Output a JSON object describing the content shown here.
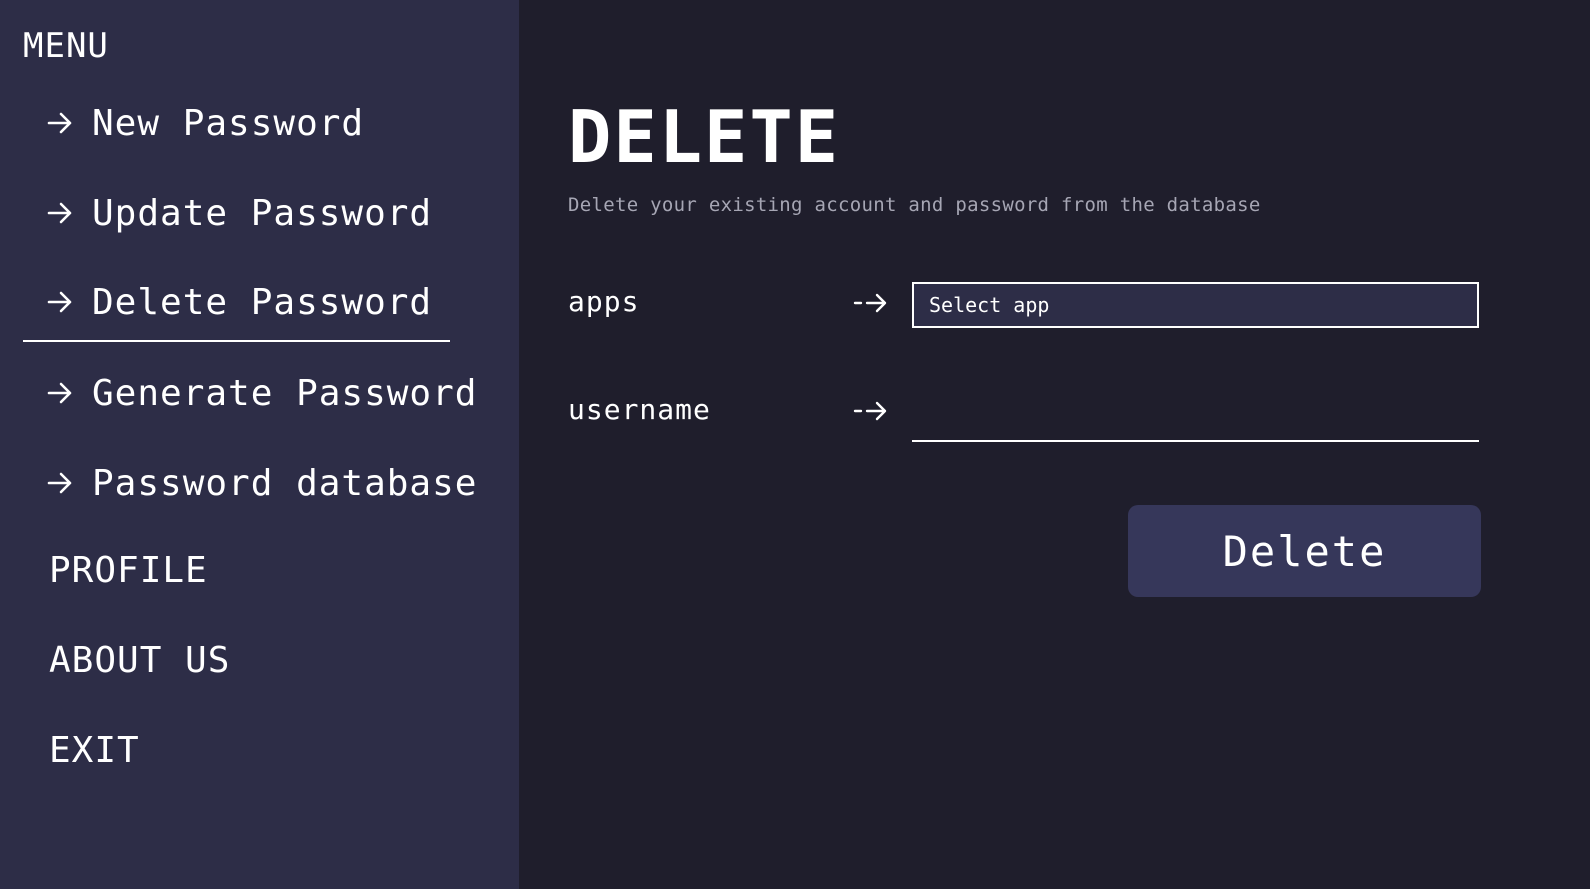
{
  "sidebar": {
    "heading": "MENU",
    "items": [
      {
        "label": "New Password",
        "icon": "arrow-right-icon"
      },
      {
        "label": "Update Password",
        "icon": "arrow-right-icon"
      },
      {
        "label": "Delete Password",
        "icon": "arrow-right-icon",
        "active": true
      },
      {
        "label": "Generate Password",
        "icon": "arrow-right-icon"
      },
      {
        "label": "Password database",
        "icon": "arrow-right-icon"
      }
    ],
    "sections": [
      {
        "label": "PROFILE"
      },
      {
        "label": "ABOUT US"
      },
      {
        "label": "EXIT"
      }
    ]
  },
  "main": {
    "title": "DELETE",
    "subtitle": "Delete your existing account and password from the database",
    "fields": {
      "apps": {
        "label": "apps",
        "select_value": "Select app"
      },
      "username": {
        "label": "username",
        "value": ""
      }
    },
    "delete_button_label": "Delete"
  },
  "colors": {
    "sidebar_bg": "#2d2d47",
    "main_bg": "#1f1e2c",
    "button_bg": "#36375a",
    "subtitle_text": "#a6a6b4"
  }
}
